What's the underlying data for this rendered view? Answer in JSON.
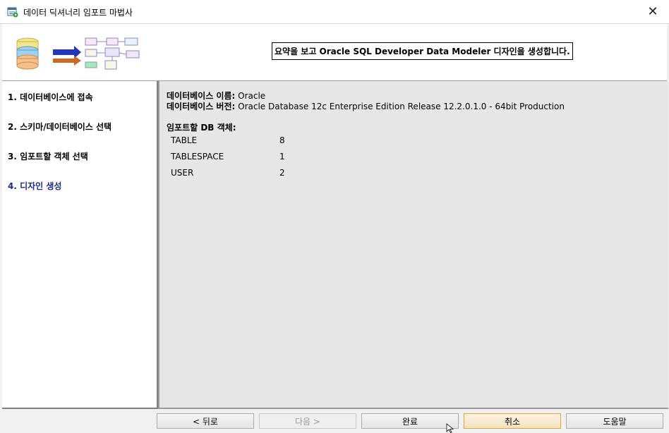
{
  "window": {
    "title": "데이터 딕셔너리 임포트 마법사",
    "close_glyph": "✕"
  },
  "banner": {
    "message": "요약을 보고 Oracle SQL Developer Data Modeler 디자인을 생성합니다."
  },
  "steps": [
    {
      "label": "1. 데이터베이스에 접속",
      "active": false
    },
    {
      "label": "2. 스키마/데이터베이스 선택",
      "active": false
    },
    {
      "label": "3. 임포트할 객체 선택",
      "active": false
    },
    {
      "label": "4. 디자인 생성",
      "active": true
    }
  ],
  "summary": {
    "db_name_label": "데이터베이스 이름:",
    "db_name_value": "Oracle",
    "db_version_label": "데이터베이스 버전:",
    "db_version_value": "Oracle Database 12c Enterprise Edition Release 12.2.0.1.0 - 64bit Production",
    "objects_heading": "임포트할 DB 객체:",
    "objects": [
      {
        "name": "TABLE",
        "count": "8"
      },
      {
        "name": "TABLESPACE",
        "count": "1"
      },
      {
        "name": "USER",
        "count": "2"
      }
    ]
  },
  "buttons": {
    "back": "< 뒤로",
    "next": "다음 >",
    "finish": "완료",
    "cancel": "취소",
    "help": "도움말"
  },
  "colors": {
    "active_step": "#1a2b8a",
    "summary_bg": "#e6e6e6",
    "focus_border": "#e8a13a"
  }
}
